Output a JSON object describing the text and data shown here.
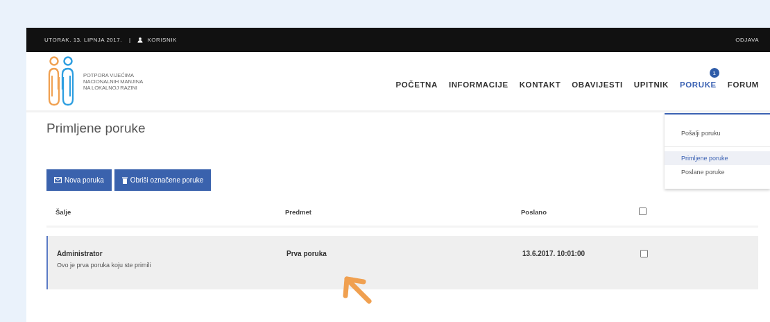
{
  "top_bar": {
    "date": "UTORAK. 13. LIPNJA 2017.",
    "separator": "|",
    "user": "KORISNIK",
    "logout": "ODJAVA"
  },
  "logo": {
    "lines": [
      "POTPORA VIJEĆIMA",
      "NACIONALNIH MANJINA",
      "NA LOKALNOJ RAZINI"
    ]
  },
  "nav": [
    {
      "label": "POČETNA",
      "selected": false
    },
    {
      "label": "INFORMACIJE",
      "selected": false
    },
    {
      "label": "KONTAKT",
      "selected": false
    },
    {
      "label": "OBAVIJESTI",
      "selected": false
    },
    {
      "label": "UPITNIK",
      "selected": false
    },
    {
      "label": "PORUKE",
      "selected": true,
      "badge": "1"
    },
    {
      "label": "FORUM",
      "selected": false
    }
  ],
  "dropdown": [
    {
      "label": "Pošalji poruku",
      "selected": false
    },
    {
      "label": "Primljene poruke",
      "selected": true
    },
    {
      "label": "Poslane poruke",
      "selected": false
    }
  ],
  "page_title": "Primljene poruke",
  "buttons": [
    {
      "label": "Nova poruka",
      "kind": "mail"
    },
    {
      "label": "Obriši označene poruke",
      "kind": "trash"
    }
  ],
  "table": {
    "columns": [
      "Šalje",
      "Predmet",
      "Poslano"
    ],
    "header_checked": false,
    "rows": [
      {
        "sender": "Administrator",
        "preview": "Ovo je prva poruka koju ste primili",
        "subject": "Prva poruka",
        "sent": "13.6.2017. 10:01:00",
        "checked": false,
        "selected": true
      }
    ]
  }
}
